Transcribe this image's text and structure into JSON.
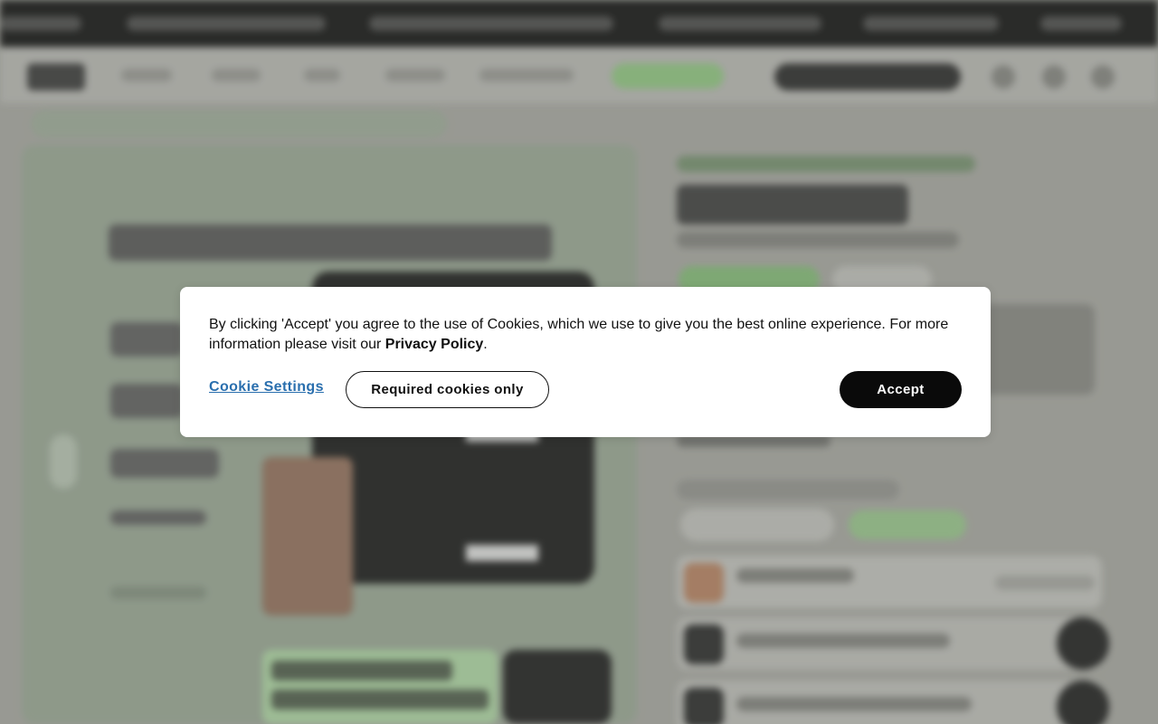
{
  "cookie_banner": {
    "message_prefix": "By clicking 'Accept' you agree to the use of Cookies, which we use to give you the best online experience. For more information please visit our ",
    "policy_link": "Privacy Policy",
    "message_suffix": ".",
    "settings_link": "Cookie Settings",
    "required_button": "Required cookies only",
    "accept_button": "Accept"
  }
}
